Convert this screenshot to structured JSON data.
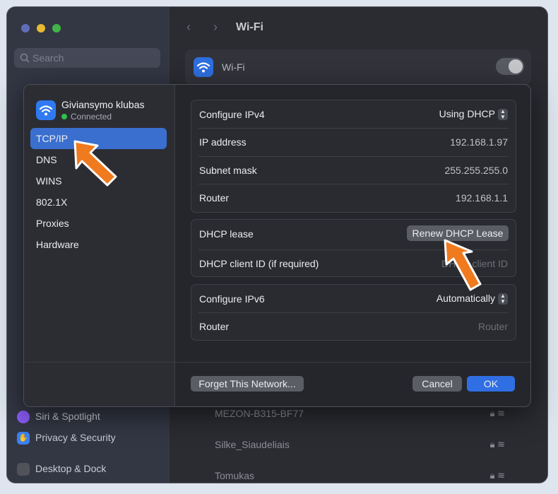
{
  "window": {
    "title": "Wi-Fi",
    "search_placeholder": "Search",
    "wifi_label": "Wi-Fi",
    "sidebar_items": [
      {
        "label": "Siri & Spotlight",
        "color": "#8b5cf6"
      },
      {
        "label": "Privacy & Security",
        "color": "#3b82f6"
      },
      {
        "label": "Desktop & Dock",
        "color": "#52525b"
      }
    ],
    "networks": [
      {
        "name": "MEZON-B315-BF77"
      },
      {
        "name": "Silke_Siaudeliais"
      },
      {
        "name": "Tomukas"
      }
    ]
  },
  "dialog": {
    "network_name": "Giviansymo klubas",
    "network_status": "Connected",
    "menu": [
      "TCP/IP",
      "DNS",
      "WINS",
      "802.1X",
      "Proxies",
      "Hardware"
    ],
    "active_menu": "TCP/IP",
    "ipv4": {
      "configure_label": "Configure IPv4",
      "configure_value": "Using DHCP",
      "ip_label": "IP address",
      "ip_value": "192.168.1.97",
      "subnet_label": "Subnet mask",
      "subnet_value": "255.255.255.0",
      "router_label": "Router",
      "router_value": "192.168.1.1"
    },
    "dhcp": {
      "lease_label": "DHCP lease",
      "renew_button": "Renew DHCP Lease",
      "client_id_label": "DHCP client ID (if required)",
      "client_id_placeholder": "DHCP client ID"
    },
    "ipv6": {
      "configure_label": "Configure IPv6",
      "configure_value": "Automatically",
      "router_label": "Router",
      "router_value": "Router"
    },
    "buttons": {
      "forget": "Forget This Network...",
      "cancel": "Cancel",
      "ok": "OK"
    }
  },
  "colors": {
    "accent": "#2f6fe3",
    "selection": "#3a6fd0",
    "annotation_arrow": "#f07a1e",
    "connected": "#30c04c"
  }
}
